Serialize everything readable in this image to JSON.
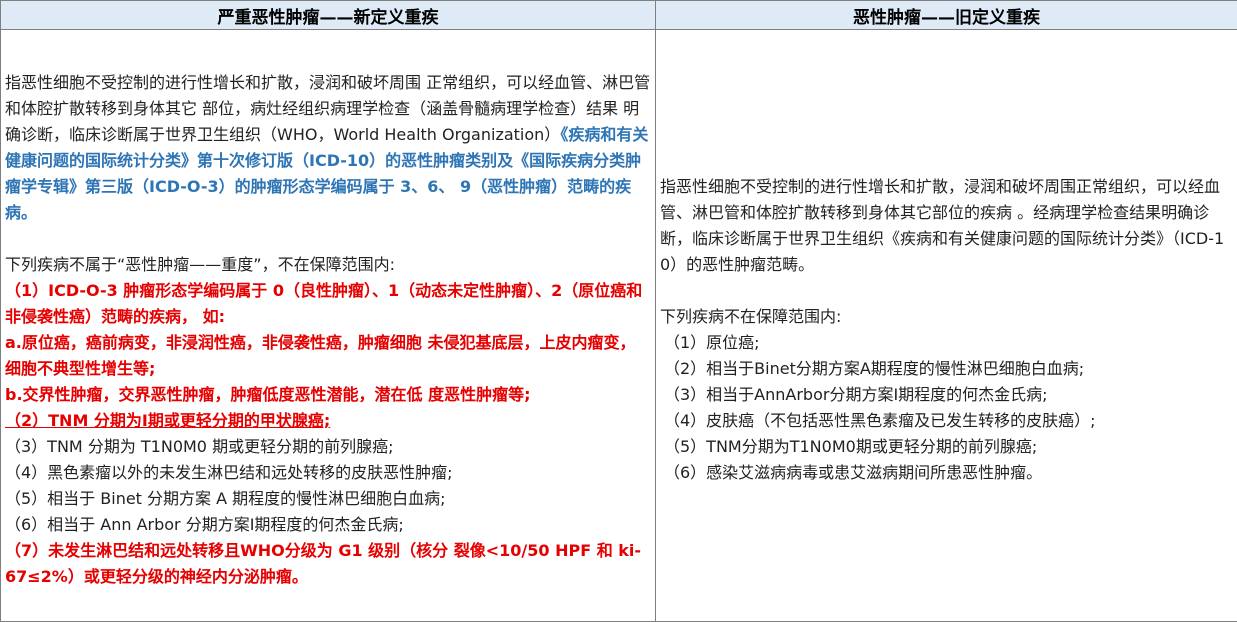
{
  "header": {
    "left": "严重恶性肿瘤——新定义重疾",
    "right": "恶性肿瘤——旧定义重疾"
  },
  "left": {
    "def_normal": "指恶性细胞不受控制的进行性增长和扩散，浸润和破坏周围 正常组织，可以经血管、淋巴管和体腔扩散转移到身体其它 部位，病灶经组织病理学检查（涵盖骨髓病理学检查）结果 明确诊断，临床诊断属于世界卫生组织（WHO，World Health Organization）",
    "def_blue": "《疾病和有关健康问题的国际统计分类》第十次修订版（ICD-10）的恶性肿瘤类别及《国际疾病分类肿 瘤学专辑》第三版（ICD-O-3）的肿瘤形态学编码属于 3、6、 9（恶性肿瘤）范畴的疾病。",
    "excl_intro": "下列疾病不属于“恶性肿瘤——重度”，不在保障范围内:",
    "items": [
      {
        "text": "（1）ICD-O-3 肿瘤形态学编码属于 0（良性肿瘤）、1（动态未定性肿瘤）、2（原位癌和非侵袭性癌）范畴的疾病， 如:",
        "style": "red"
      },
      {
        "text": "a.原位癌，癌前病变，非浸润性癌，非侵袭性癌，肿瘤细胞 未侵犯基底层，上皮内瘤变，细胞不典型性增生等;",
        "style": "red"
      },
      {
        "text": "b.交界性肿瘤，交界恶性肿瘤，肿瘤低度恶性潜能，潜在低 度恶性肿瘤等;",
        "style": "red"
      },
      {
        "text": "（2）TNM 分期为Ⅰ期或更轻分期的甲状腺癌;",
        "style": "red-under"
      },
      {
        "text": "（3）TNM 分期为 T1N0M0 期或更轻分期的前列腺癌;",
        "style": "normal"
      },
      {
        "text": "（4）黑色素瘤以外的未发生淋巴结和远处转移的皮肤恶性肿瘤;",
        "style": "normal"
      },
      {
        "text": "（5）相当于 Binet 分期方案 A 期程度的慢性淋巴细胞白血病;",
        "style": "normal"
      },
      {
        "text": "（6）相当于 Ann Arbor 分期方案Ⅰ期程度的何杰金氏病;",
        "style": "normal"
      },
      {
        "text": "（7）未发生淋巴结和远处转移且WHO分级为 G1 级别（核分 裂像<10/50 HPF 和 ki-67≤2%）或更轻分级的神经内分泌肿瘤。",
        "style": "red"
      }
    ]
  },
  "right": {
    "definition": "指恶性细胞不受控制的进行性增长和扩散，浸润和破坏周围正常组织，可以经血管、淋巴管和体腔扩散转移到身体其它部位的疾病 。经病理学检查结果明确诊断，临床诊断属于世界卫生组织《疾病和有关健康问题的国际统计分类》（ICD-10）的恶性肿瘤范畴。",
    "excl_intro": "下列疾病不在保障范围内:",
    "items": [
      "（1）原位癌;",
      "（2）相当于Binet分期方案A期程度的慢性淋巴细胞白血病;",
      "（3）相当于AnnArbor分期方案I期程度的何杰金氏病;",
      "（4）皮肤癌（不包括恶性黑色素瘤及已发生转移的皮肤癌）;",
      "（5）TNM分期为T1N0M0期或更轻分期的前列腺癌;",
      "（6）感染艾滋病病毒或患艾滋病期间所患恶性肿瘤。"
    ]
  },
  "colors": {
    "header_bg": "#deebf7",
    "blue": "#2e75b6",
    "red": "#e60000",
    "border": "#7f7f7f"
  }
}
